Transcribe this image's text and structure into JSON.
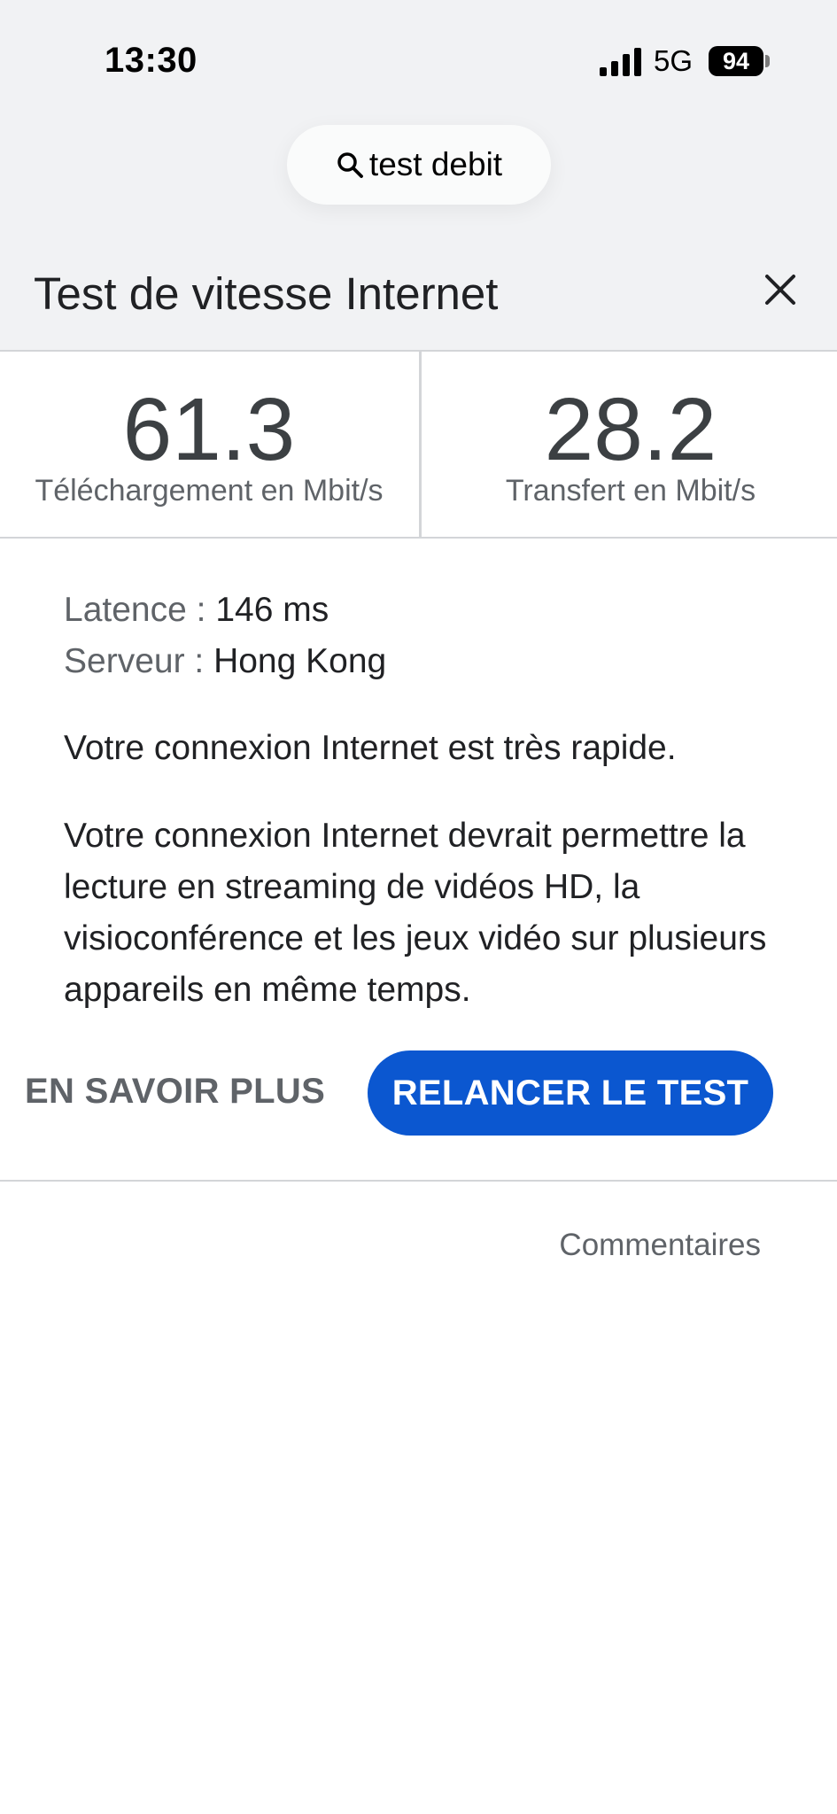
{
  "status_bar": {
    "time": "13:30",
    "network": "5G",
    "battery": "94"
  },
  "search": {
    "query": "test debit"
  },
  "card": {
    "title": "Test de vitesse Internet"
  },
  "stats": {
    "download": {
      "value": "61.3",
      "label": "Téléchargement en Mbit/s"
    },
    "upload": {
      "value": "28.2",
      "label": "Transfert en Mbit/s"
    }
  },
  "details": {
    "latency_label": "Latence :",
    "latency_value": "146 ms",
    "server_label": "Serveur :",
    "server_value": "Hong Kong"
  },
  "messages": {
    "speed_summary": "Votre connexion Internet est très rapide.",
    "speed_description": "Votre connexion Internet devrait permettre la lecture en streaming de vidéos HD, la visioconférence et les jeux vidéo sur plusieurs appareils en même temps."
  },
  "actions": {
    "learn_more": "EN SAVOIR PLUS",
    "rerun": "RELANCER LE TEST"
  },
  "footer": {
    "feedback": "Commentaires"
  },
  "colors": {
    "accent": "#0b57d0",
    "top_background": "#f1f2f4"
  }
}
